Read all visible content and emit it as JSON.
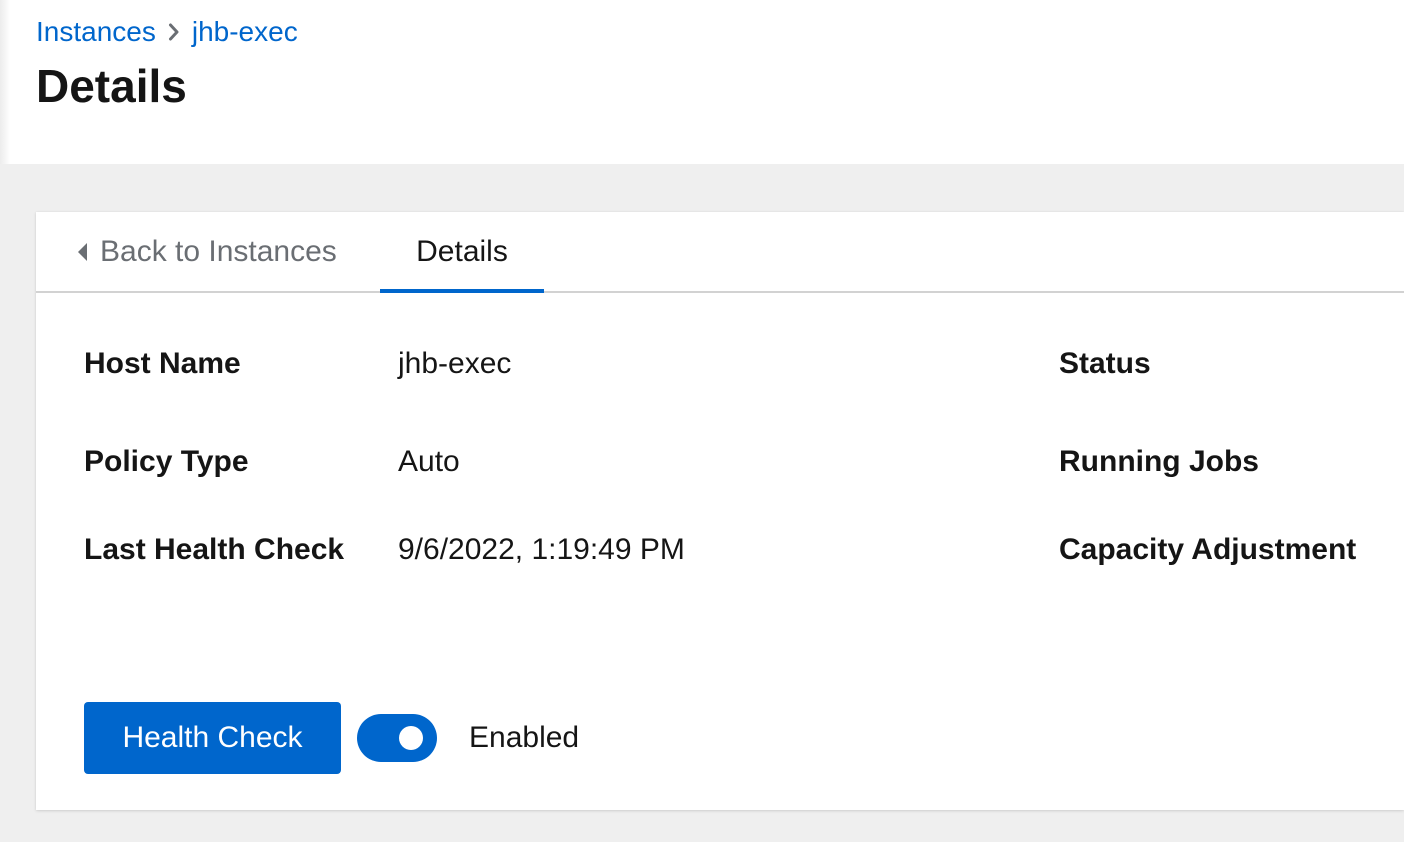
{
  "breadcrumb": {
    "items": [
      "Instances",
      "jhb-exec"
    ]
  },
  "page": {
    "title": "Details"
  },
  "tabs": {
    "back_label": "Back to Instances",
    "details_label": "Details"
  },
  "details": {
    "host_name": {
      "label": "Host Name",
      "value": "jhb-exec"
    },
    "policy_type": {
      "label": "Policy Type",
      "value": "Auto"
    },
    "last_health_check": {
      "label": "Last Health Check",
      "value": "9/6/2022, 1:19:49 PM"
    },
    "status": {
      "label": "Status"
    },
    "running_jobs": {
      "label": "Running Jobs"
    },
    "capacity_adjustment": {
      "label": "Capacity Adjustment"
    }
  },
  "actions": {
    "health_check_label": "Health Check",
    "toggle_label": "Enabled",
    "toggle_on": true
  },
  "colors": {
    "accent": "#0066cc",
    "page_background": "#efefef",
    "text": "#151515",
    "muted_text": "#6a6e73"
  },
  "icons": {
    "breadcrumb_separator": "chevron-right-icon",
    "back_tab": "caret-left-icon"
  }
}
